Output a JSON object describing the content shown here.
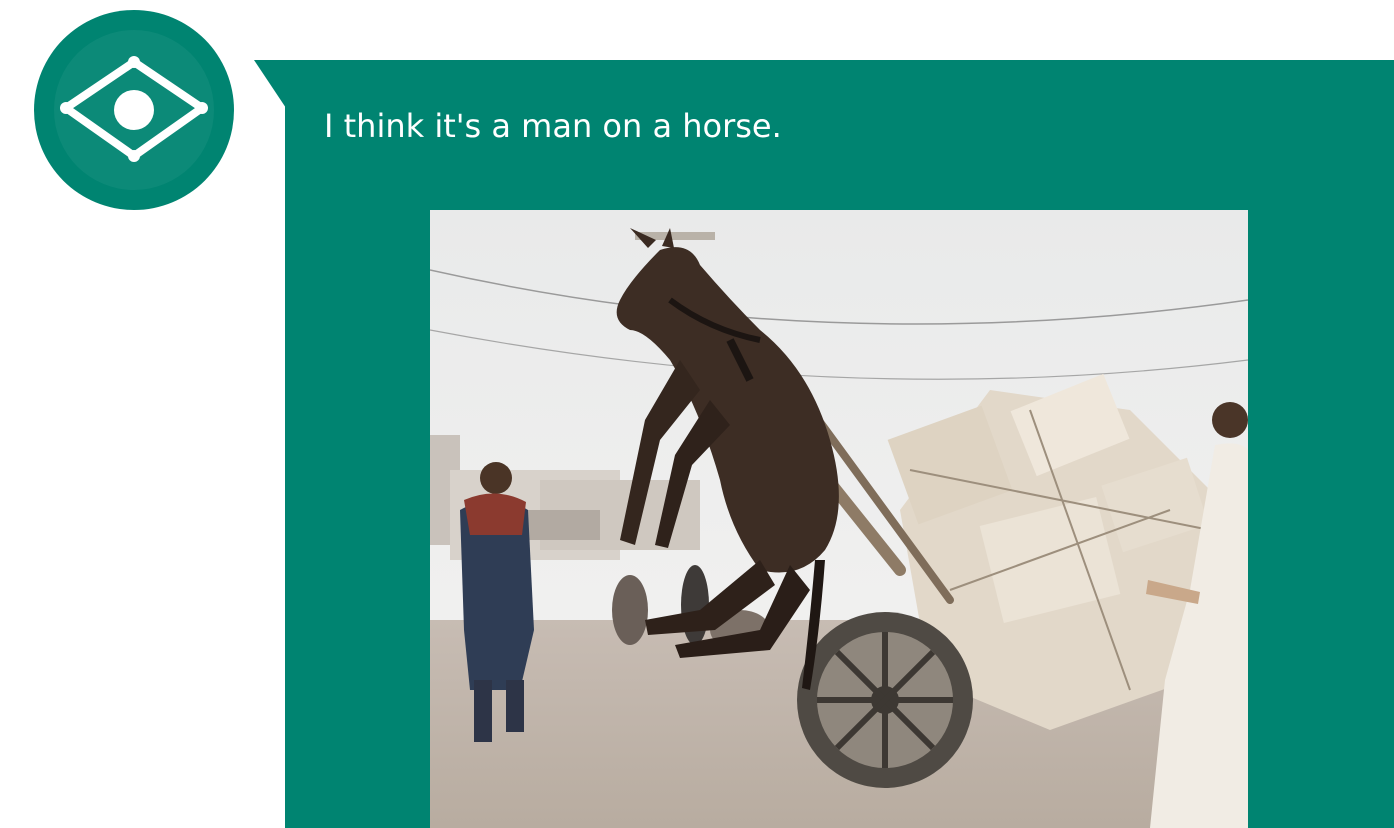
{
  "assistant": {
    "avatar_icon": "eye-diamond-icon",
    "avatar_color": "#008471"
  },
  "message": {
    "text": "I think it's a man on a horse.",
    "bubble_color": "#008471",
    "text_color": "#ffffff"
  },
  "attachment": {
    "type": "photo",
    "alt": "Donkey reared up on its hind legs by an overloaded cart piled with boxes, men on a dusty street"
  }
}
